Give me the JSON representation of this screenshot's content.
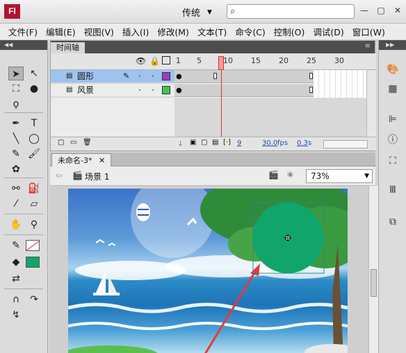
{
  "app": {
    "logo": "Fl",
    "workspace": "传统",
    "search_placeholder": ""
  },
  "menu": [
    "文件(F)",
    "编辑(E)",
    "视图(V)",
    "插入(I)",
    "修改(M)",
    "文本(T)",
    "命令(C)",
    "控制(O)",
    "调试(D)",
    "窗口(W)"
  ],
  "timeline": {
    "tab": "时间轴",
    "frame_numbers": [
      "1",
      "5",
      "10",
      "15",
      "20",
      "25",
      "30"
    ],
    "layers": [
      {
        "name": "圆形",
        "color": "#9b3fc6",
        "selected": true
      },
      {
        "name": "风景",
        "color": "#3ec84a",
        "selected": false
      }
    ],
    "current_frame": "9",
    "fps": "30.0",
    "fps_unit": "fps",
    "time": "0.3",
    "time_unit": "s"
  },
  "document": {
    "tab": "未命名-3*",
    "scene": "场景 1",
    "zoom": "73%"
  },
  "colors": {
    "fill": "#11a56b",
    "stroke": "none"
  }
}
